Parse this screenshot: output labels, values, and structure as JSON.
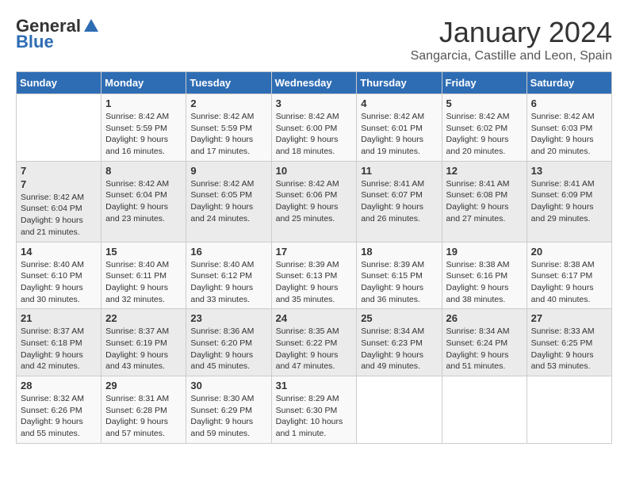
{
  "logo": {
    "general": "General",
    "blue": "Blue"
  },
  "header": {
    "month": "January 2024",
    "location": "Sangarcia, Castille and Leon, Spain"
  },
  "days_of_week": [
    "Sunday",
    "Monday",
    "Tuesday",
    "Wednesday",
    "Thursday",
    "Friday",
    "Saturday"
  ],
  "weeks": [
    [
      {
        "day": "",
        "content": ""
      },
      {
        "day": "1",
        "content": "Sunrise: 8:42 AM\nSunset: 5:59 PM\nDaylight: 9 hours\nand 16 minutes."
      },
      {
        "day": "2",
        "content": "Sunrise: 8:42 AM\nSunset: 5:59 PM\nDaylight: 9 hours\nand 17 minutes."
      },
      {
        "day": "3",
        "content": "Sunrise: 8:42 AM\nSunset: 6:00 PM\nDaylight: 9 hours\nand 18 minutes."
      },
      {
        "day": "4",
        "content": "Sunrise: 8:42 AM\nSunset: 6:01 PM\nDaylight: 9 hours\nand 19 minutes."
      },
      {
        "day": "5",
        "content": "Sunrise: 8:42 AM\nSunset: 6:02 PM\nDaylight: 9 hours\nand 20 minutes."
      },
      {
        "day": "6",
        "content": "Sunrise: 8:42 AM\nSunset: 6:03 PM\nDaylight: 9 hours\nand 20 minutes."
      }
    ],
    [
      {
        "day": "7",
        "content": ""
      },
      {
        "day": "8",
        "content": "Sunrise: 8:42 AM\nSunset: 6:04 PM\nDaylight: 9 hours\nand 23 minutes."
      },
      {
        "day": "9",
        "content": "Sunrise: 8:42 AM\nSunset: 6:05 PM\nDaylight: 9 hours\nand 24 minutes."
      },
      {
        "day": "10",
        "content": "Sunrise: 8:42 AM\nSunset: 6:06 PM\nDaylight: 9 hours\nand 25 minutes."
      },
      {
        "day": "11",
        "content": "Sunrise: 8:41 AM\nSunset: 6:07 PM\nDaylight: 9 hours\nand 26 minutes."
      },
      {
        "day": "12",
        "content": "Sunrise: 8:41 AM\nSunset: 6:08 PM\nDaylight: 9 hours\nand 27 minutes."
      },
      {
        "day": "13",
        "content": "Sunrise: 8:41 AM\nSunset: 6:09 PM\nDaylight: 9 hours\nand 29 minutes."
      }
    ],
    [
      {
        "day": "14",
        "content": "Sunrise: 8:40 AM\nSunset: 6:10 PM\nDaylight: 9 hours\nand 30 minutes."
      },
      {
        "day": "15",
        "content": "Sunrise: 8:40 AM\nSunset: 6:11 PM\nDaylight: 9 hours\nand 32 minutes."
      },
      {
        "day": "16",
        "content": "Sunrise: 8:40 AM\nSunset: 6:12 PM\nDaylight: 9 hours\nand 33 minutes."
      },
      {
        "day": "17",
        "content": "Sunrise: 8:39 AM\nSunset: 6:13 PM\nDaylight: 9 hours\nand 35 minutes."
      },
      {
        "day": "18",
        "content": "Sunrise: 8:39 AM\nSunset: 6:15 PM\nDaylight: 9 hours\nand 36 minutes."
      },
      {
        "day": "19",
        "content": "Sunrise: 8:38 AM\nSunset: 6:16 PM\nDaylight: 9 hours\nand 38 minutes."
      },
      {
        "day": "20",
        "content": "Sunrise: 8:38 AM\nSunset: 6:17 PM\nDaylight: 9 hours\nand 40 minutes."
      }
    ],
    [
      {
        "day": "21",
        "content": "Sunrise: 8:37 AM\nSunset: 6:18 PM\nDaylight: 9 hours\nand 42 minutes."
      },
      {
        "day": "22",
        "content": "Sunrise: 8:37 AM\nSunset: 6:19 PM\nDaylight: 9 hours\nand 43 minutes."
      },
      {
        "day": "23",
        "content": "Sunrise: 8:36 AM\nSunset: 6:20 PM\nDaylight: 9 hours\nand 45 minutes."
      },
      {
        "day": "24",
        "content": "Sunrise: 8:35 AM\nSunset: 6:22 PM\nDaylight: 9 hours\nand 47 minutes."
      },
      {
        "day": "25",
        "content": "Sunrise: 8:34 AM\nSunset: 6:23 PM\nDaylight: 9 hours\nand 49 minutes."
      },
      {
        "day": "26",
        "content": "Sunrise: 8:34 AM\nSunset: 6:24 PM\nDaylight: 9 hours\nand 51 minutes."
      },
      {
        "day": "27",
        "content": "Sunrise: 8:33 AM\nSunset: 6:25 PM\nDaylight: 9 hours\nand 53 minutes."
      }
    ],
    [
      {
        "day": "28",
        "content": "Sunrise: 8:32 AM\nSunset: 6:26 PM\nDaylight: 9 hours\nand 55 minutes."
      },
      {
        "day": "29",
        "content": "Sunrise: 8:31 AM\nSunset: 6:28 PM\nDaylight: 9 hours\nand 57 minutes."
      },
      {
        "day": "30",
        "content": "Sunrise: 8:30 AM\nSunset: 6:29 PM\nDaylight: 9 hours\nand 59 minutes."
      },
      {
        "day": "31",
        "content": "Sunrise: 8:29 AM\nSunset: 6:30 PM\nDaylight: 10 hours\nand 1 minute."
      },
      {
        "day": "",
        "content": ""
      },
      {
        "day": "",
        "content": ""
      },
      {
        "day": "",
        "content": ""
      }
    ]
  ]
}
